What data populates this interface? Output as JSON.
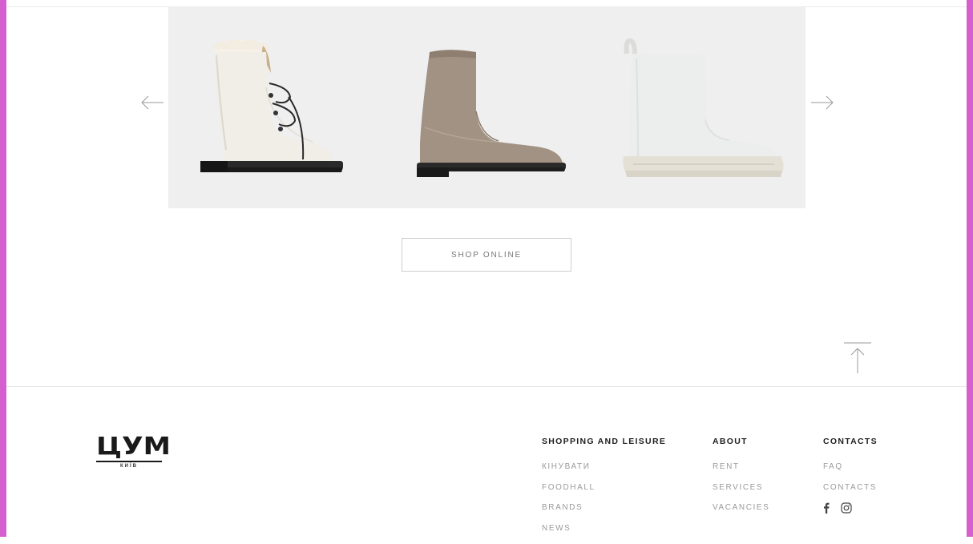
{
  "carousel": {
    "prev_label": "previous",
    "next_label": "next",
    "products": [
      {
        "name": "white-lace-up-boot",
        "color": "#f0ede6"
      },
      {
        "name": "taupe-sock-boot",
        "color": "#9b8a7a"
      },
      {
        "name": "white-chunky-boot",
        "color": "#e9e9e6"
      }
    ]
  },
  "shop_button": {
    "label": "SHOP ONLINE"
  },
  "logo": {
    "main": "ЦУМ",
    "sub": "КИЇВ"
  },
  "footer": {
    "columns": [
      {
        "title": "SHOPPING AND LEISURE",
        "links": [
          "КІНУВАТИ",
          "FOODHALL",
          "BRANDS",
          "NEWS"
        ]
      },
      {
        "title": "ABOUT",
        "links": [
          "RENT",
          "SERVICES",
          "VACANCIES"
        ]
      },
      {
        "title": "CONTACTS",
        "links": [
          "FAQ",
          "CONTACTS"
        ],
        "social": [
          "facebook-icon",
          "instagram-icon"
        ]
      }
    ]
  },
  "colors": {
    "frame": "#d55fcf",
    "carousel_bg": "#efefef",
    "muted_text": "#9a9a9a",
    "heading_text": "#1f1f1f"
  }
}
